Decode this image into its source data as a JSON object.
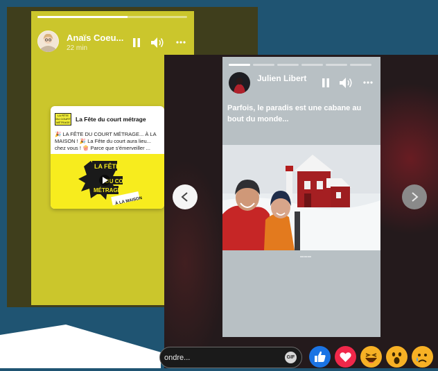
{
  "colors": {
    "background": "#1f5472",
    "story_a_panel": "#cbc62c",
    "story_b_panel": "#b8c0c4",
    "like": "#1b74e4",
    "love": "#f0284a",
    "emoji": "#f7b125"
  },
  "story_a": {
    "author_name": "Anaïs Coeu...",
    "time": "22 min",
    "progress_fraction": 0.6,
    "shared_post": {
      "page_title": "La Fête du court métrage",
      "text": "🎉 LA FÊTE DU COURT MÉTRAGE... À LA MAISON ! 🎉 La Fête du court aura lieu... chez vous ! 🍿 Parce que s'émerveiller ...",
      "logo_text": "LA FÊTE DU COURT MÉTRAGE",
      "poster": {
        "line1": "LA FÊTE",
        "line2": "DU COURT",
        "line3": "MÉTRAGE",
        "line4": "À LA MAISON"
      }
    }
  },
  "story_b": {
    "author_name": "Julien Libert",
    "caption": "Parfois, le paradis est une cabane au bout du monde...",
    "progress_segments": 6,
    "progress_fraction_first": 1.0
  },
  "nav": {
    "prev_icon": "chevron-left-icon",
    "next_icon": "chevron-right-icon"
  },
  "reply": {
    "placeholder_visible": "ondre...",
    "gif_label": "GIF"
  },
  "reactions": [
    "like-icon",
    "love-icon",
    "haha-icon",
    "wow-icon",
    "sad-icon"
  ]
}
